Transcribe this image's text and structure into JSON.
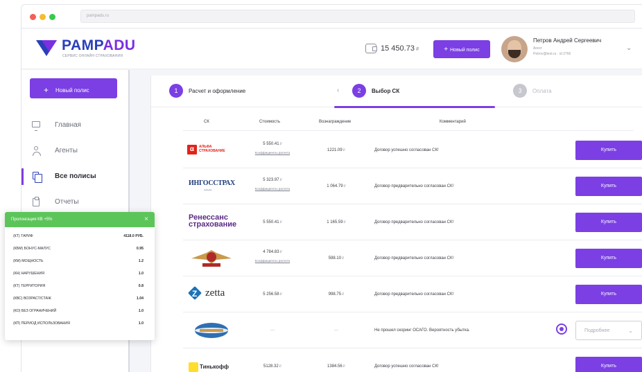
{
  "browser": {
    "url": "pampadu.ru"
  },
  "brand": {
    "name_part1": "PAMP",
    "name_part2": "ADU",
    "tagline": "СЕРВИС ОНЛАЙН СТРАХОВАНИЯ"
  },
  "header": {
    "balance": "15 450.73",
    "balance_currency": "₽",
    "new_policy_label": "Новый полис",
    "user": {
      "name": "Петров Андрей Сергеевич",
      "role": "Агент",
      "email": "Petrov@test.ru · id 2766"
    }
  },
  "sidebar": {
    "new_policy_label": "Новый полис",
    "items": [
      {
        "label": "Главная",
        "icon": "monitor-icon",
        "active": false
      },
      {
        "label": "Агенты",
        "icon": "person-icon",
        "active": false
      },
      {
        "label": "Все полисы",
        "icon": "copy-icon",
        "active": true
      },
      {
        "label": "Отчеты",
        "icon": "clipboard-icon",
        "active": false
      }
    ]
  },
  "steps": [
    {
      "num": "1",
      "label": "Расчет и оформление"
    },
    {
      "num": "2",
      "label": "Выбор СК"
    },
    {
      "num": "3",
      "label": "Оплата"
    }
  ],
  "table": {
    "columns": [
      "СК",
      "Стоимость",
      "Вознаграждение",
      "Комментарий"
    ],
    "buy_label": "Купить",
    "details_label": "Подробнее",
    "coef_link": "Коэффициенты расчета",
    "rows": [
      {
        "logo": "АЛЬФА СТРАХОВАНИЕ",
        "price": "5 550.41",
        "reward": "1221.09",
        "comment": "Договор успешно согласован СК!"
      },
      {
        "logo": "ИНГОССТРАХ",
        "price": "5 323.97",
        "reward": "1 064.79",
        "comment": "Договор предварительно согласован СК!"
      },
      {
        "logo": "Ренессанс страхование",
        "price": "5 550.41",
        "reward": "1 165.59",
        "comment": "Договор предварительно согласован СК!"
      },
      {
        "logo": "",
        "price": "4 784.83",
        "reward": "598.10",
        "comment": "Договор предварительно согласован СК!"
      },
      {
        "logo": "zetta",
        "price": "5 256.58",
        "reward": "998.75",
        "comment": "Договор предварительно согласован СК!"
      },
      {
        "logo": "",
        "price": "—",
        "reward": "—",
        "comment": "Не прошел скоринг ОСАГО. Вероятность убытка."
      },
      {
        "logo": "Тинькофф",
        "price": "5128.32",
        "reward": "1384.56",
        "comment": "Договор успешно согласован СК!"
      }
    ],
    "currency": "₽"
  },
  "popup": {
    "title": "Пролонгация КВ +5%",
    "rows": [
      {
        "key": "(КТ) Тариф",
        "value": "4118.0 РУБ."
      },
      {
        "key": "(КБМ) Бонус-малус",
        "value": "0.95"
      },
      {
        "key": "(КМ) Мощность",
        "value": "1.2"
      },
      {
        "key": "(КН) Нарушения",
        "value": "1.0"
      },
      {
        "key": "(КТ) Территория",
        "value": "0.8"
      },
      {
        "key": "(КВС) Возраст/стаж",
        "value": "1.04"
      },
      {
        "key": "(КО) Без ограничений",
        "value": "1.0"
      },
      {
        "key": "(КП) Период использования",
        "value": "1.0"
      }
    ]
  },
  "colors": {
    "accent": "#7b3fe4",
    "brand_blue": "#2a3fb8",
    "popup_green": "#5cc55a"
  }
}
